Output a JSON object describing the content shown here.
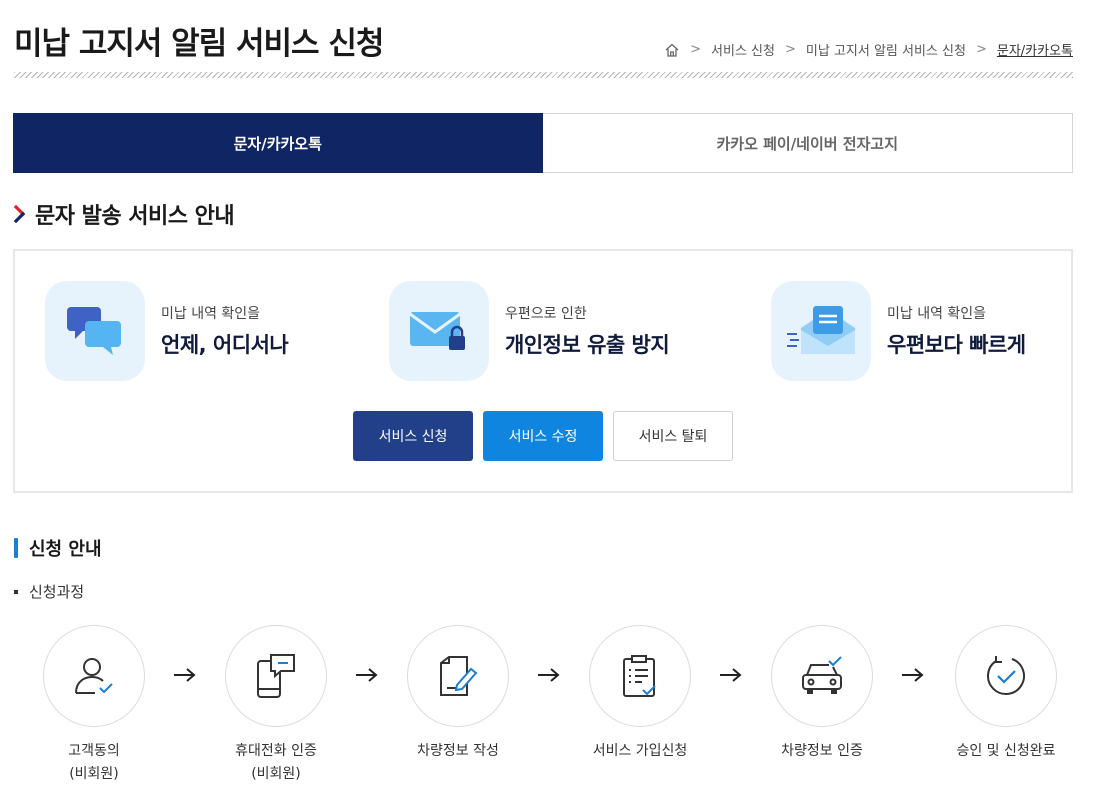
{
  "page": {
    "title": "미납 고지서 알림 서비스 신청"
  },
  "breadcrumb": {
    "home_icon": "home-icon",
    "items": [
      "서비스 신청",
      "미납 고지서 알림 서비스 신청",
      "문자/카카오톡"
    ]
  },
  "tabs": [
    {
      "label": "문자/카카오톡",
      "active": true
    },
    {
      "label": "카카오 페이/네이버 전자고지",
      "active": false
    }
  ],
  "section": {
    "title": "문자 발송 서비스 안내"
  },
  "features": [
    {
      "small": "미납 내역 확인을",
      "big": "언제, 어디서나",
      "icon": "chat-bubbles-icon"
    },
    {
      "small": "우편으로 인한",
      "big": "개인정보 유출 방지",
      "icon": "envelope-lock-icon"
    },
    {
      "small": "미납 내역 확인을",
      "big": "우편보다 빠르게",
      "icon": "fast-mail-icon"
    }
  ],
  "buttons": {
    "apply": "서비스 신청",
    "modify": "서비스 수정",
    "withdraw": "서비스 탈퇴"
  },
  "guide": {
    "title": "신청 안내",
    "process_label": "신청과정"
  },
  "steps": [
    {
      "label": "고객동의\n(비회원)",
      "icon": "user-check-icon"
    },
    {
      "label": "휴대전화 인증\n(비회원)",
      "icon": "phone-message-icon"
    },
    {
      "label": "차량정보 작성",
      "icon": "document-edit-icon"
    },
    {
      "label": "서비스 가입신청",
      "icon": "clipboard-check-icon"
    },
    {
      "label": "차량정보 인증",
      "icon": "car-check-icon"
    },
    {
      "label": "승인 및 신청완료",
      "icon": "circle-check-icon"
    }
  ],
  "colors": {
    "navy": "#102563",
    "button_navy": "#223f8a",
    "button_blue": "#1085e0",
    "accent_blue": "#1a7fd4",
    "icon_bg": "#e6f3fd"
  }
}
